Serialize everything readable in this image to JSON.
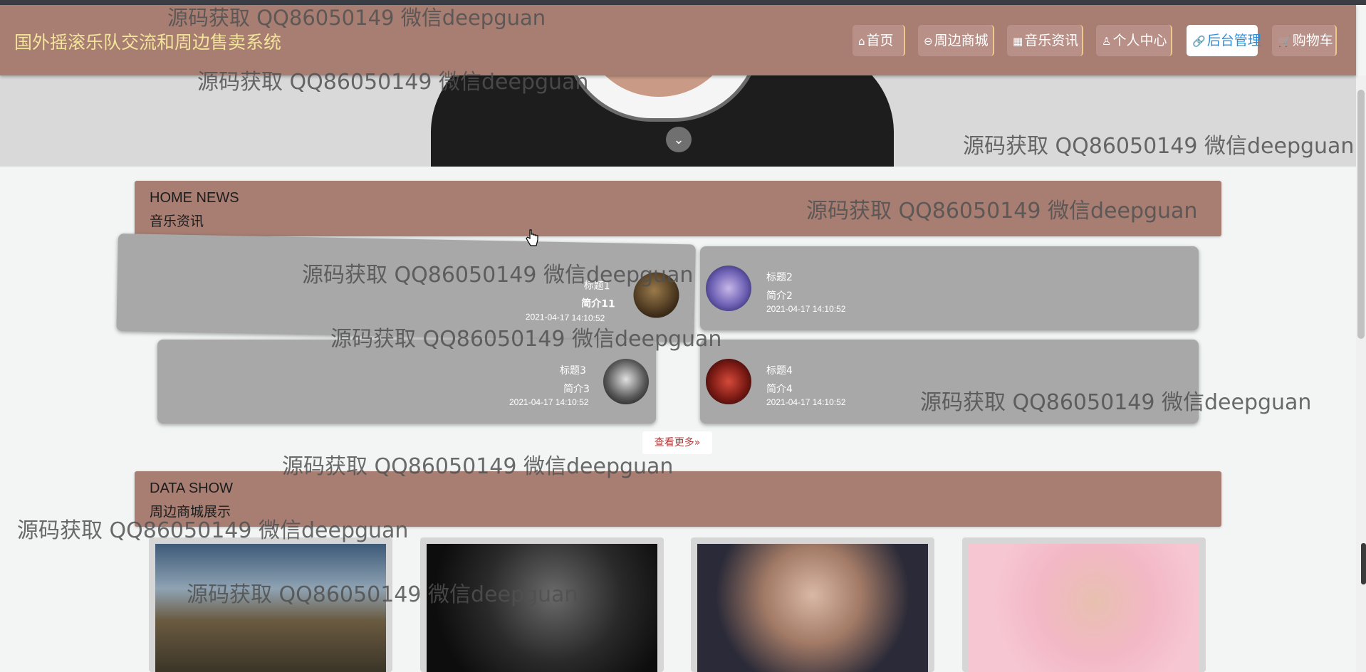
{
  "header": {
    "brand": "国外摇滚乐队交流和周边售卖系统",
    "nav": [
      {
        "label": "首页"
      },
      {
        "label": "周边商城"
      },
      {
        "label": "音乐资讯"
      },
      {
        "label": "个人中心"
      },
      {
        "label": "后台管理"
      },
      {
        "label": "购物车"
      }
    ],
    "active_nav": "后台管理"
  },
  "news_section": {
    "en_title": "HOME NEWS",
    "cn_title": "音乐资讯",
    "items": [
      {
        "title": "标题1",
        "intro": "简介11",
        "date": "2021-04-17 14:10:52"
      },
      {
        "title": "标题2",
        "intro": "简介2",
        "date": "2021-04-17 14:10:52"
      },
      {
        "title": "标题3",
        "intro": "简介3",
        "date": "2021-04-17 14:10:52"
      },
      {
        "title": "标题4",
        "intro": "简介4",
        "date": "2021-04-17 14:10:52"
      }
    ],
    "more_label": "查看更多"
  },
  "data_section": {
    "en_title": "DATA SHOW",
    "cn_title": "周边商城展示"
  },
  "watermark": "源码获取 QQ86050149 微信deepguan",
  "colors": {
    "navbar_bg": "#a87e73",
    "brand_text": "#f2e39a",
    "card_bg": "#a8a8a8",
    "page_bg": "#f2f5f4"
  }
}
